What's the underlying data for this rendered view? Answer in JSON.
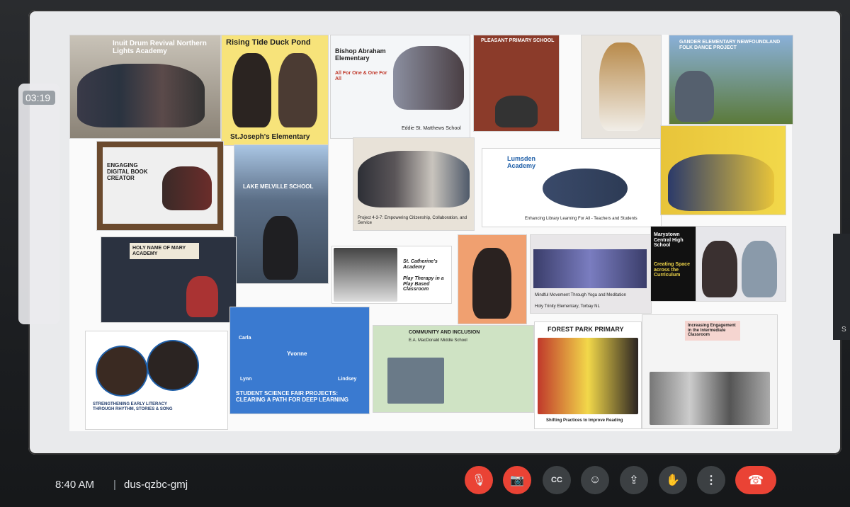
{
  "timer": "03:19",
  "meeting": {
    "time": "8:40 AM",
    "separator": "|",
    "code": "dus-qzbc-gmj"
  },
  "controls": {
    "mic": "🎙",
    "camera": "📷",
    "captions": "CC",
    "emoji": "☺",
    "present": "⇪",
    "hand": "✋",
    "more": "⋮",
    "hangup": "☎"
  },
  "colors": {
    "mic_off": "#ea4335",
    "hangup": "#ea4335",
    "control": "#3c4043"
  },
  "right_edge_label": "S",
  "tiles": {
    "inuit": "Inuit Drum Revival Northern Lights Academy",
    "rising_tide": "Rising Tide Duck Pond",
    "st_joseph": "St.Joseph's Elementary",
    "bishop": "Bishop Abraham Elementary",
    "bishop_motto": "All For One & One For All",
    "st_matthews": "Eddie St. Matthews School",
    "pleasant": "PLEASANT PRIMARY SCHOOL",
    "gander": "GANDER ELEMENTARY NEWFOUNDLAND FOLK DANCE PROJECT",
    "digital": "ENGAGING DIGITAL BOOK CREATOR",
    "lake_melville": "LAKE MELVILLE SCHOOL",
    "project": "Project 4-3-7: Empowering Citizenship, Collaboration, and Service",
    "lumsden": "Lumsden Academy",
    "lumsden_cap": "Enhancing Library Learning For All - Teachers and Students",
    "holy_name": "HOLY NAME OF MARY ACADEMY",
    "st_catherine": "St. Catherine's Academy",
    "play_therapy": "Play Therapy in a Play Based Classroom",
    "mindful": "Mindful Movement Through Yoga and Meditation",
    "holy_trinity": "Holy Trinity Elementary, Torbay NL",
    "marystown": "Marystown Central High School",
    "creating_space": "Creating Space across the Curriculum",
    "literacy": "STRENGTHENING EARLY LITERACY THROUGH RHYTHM, STORIES & SONG",
    "science": "STUDENT SCIENCE FAIR PROJECTS: CLEARING A PATH FOR DEEP LEARNING",
    "science_names": [
      "Carla",
      "Yvonne",
      "Lynn",
      "Lindsey"
    ],
    "community": "COMMUNITY AND INCLUSION",
    "macdonald": "E.A. MacDonald Middle School",
    "forest_park": "FOREST PARK PRIMARY",
    "forest_cap": "Shifting Practices to Improve Reading",
    "increasing": "Increasing Engagement in the Intermediate Classroom"
  }
}
